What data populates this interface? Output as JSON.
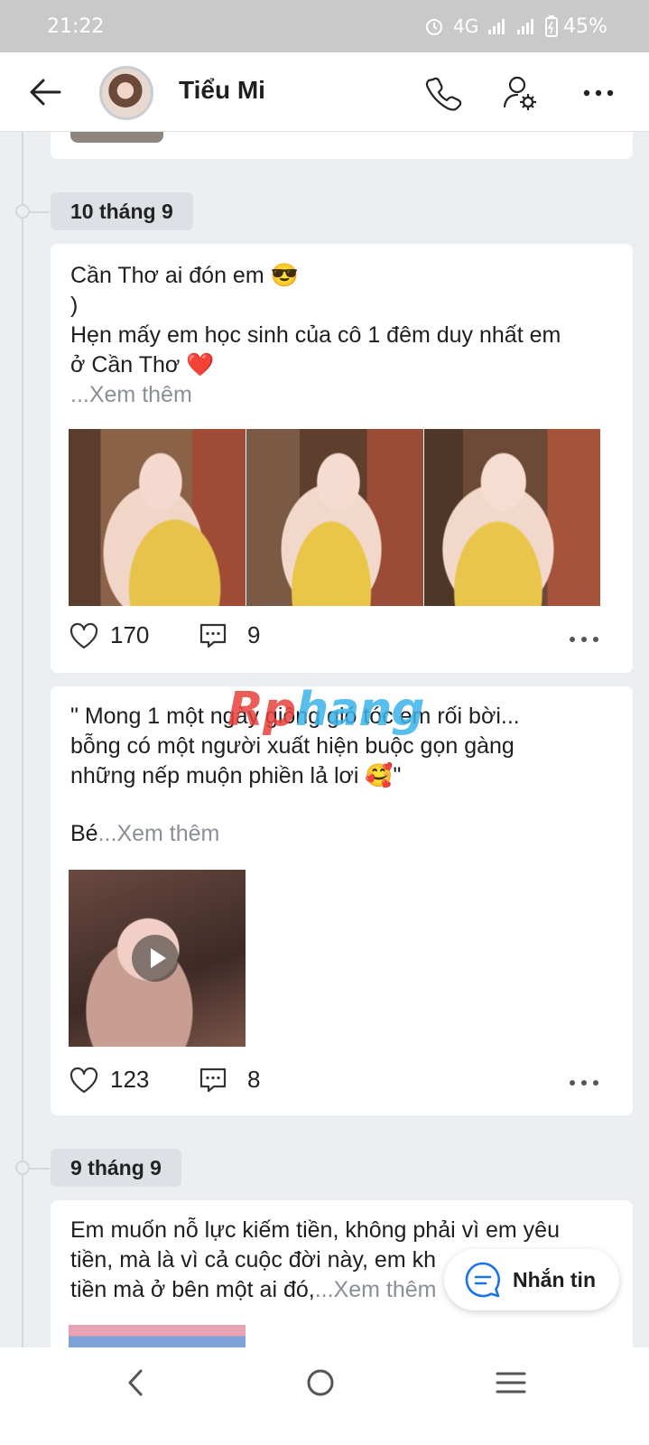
{
  "status_bar": {
    "time": "21:22",
    "network": "4G",
    "battery": "45%"
  },
  "header": {
    "title": "Tiểu Mi",
    "icons": [
      "back-arrow-icon",
      "avatar",
      "phone-icon",
      "user-settings-icon",
      "more-icon"
    ]
  },
  "watermark": {
    "part1": "Rp",
    "part2": "hang",
    "color1": "#e8413c",
    "color2": "#3bb3e8"
  },
  "dates": [
    "10 tháng 9",
    "9 tháng 9"
  ],
  "posts": [
    {
      "line1": "Cần Thơ ai đón em 😎",
      "line2": ")",
      "line3": "Hẹn mấy em học sinh của cô 1 đêm duy nhất em",
      "line4": "ở Cần Thơ ❤️",
      "more_prefix": "...",
      "more": "Xem thêm",
      "likes": "170",
      "comments": "9"
    },
    {
      "line1": "\" Mong 1 một ngày giông gió tóc em rối bời...",
      "line2": "bỗng có một người xuất hiện buộc gọn gàng",
      "line3": "những nếp muộn phiền lả lơi 🥰\"",
      "line4": "Bé",
      "more_prefix": "...",
      "more": "Xem thêm",
      "likes": "123",
      "comments": "8"
    },
    {
      "line1": "Em muốn nỗ lực kiếm tiền, không phải vì em yêu",
      "line2": "tiền, mà là vì cả cuộc đời này, em kh",
      "line3": "tiền mà ở bên một ai đó,",
      "more_prefix": "...",
      "more": "Xem thêm"
    }
  ],
  "fab": {
    "label": "Nhắn tin"
  },
  "colors": {
    "accent": "#1a73e8",
    "muted": "#8a8f96",
    "background": "#eceff2"
  }
}
